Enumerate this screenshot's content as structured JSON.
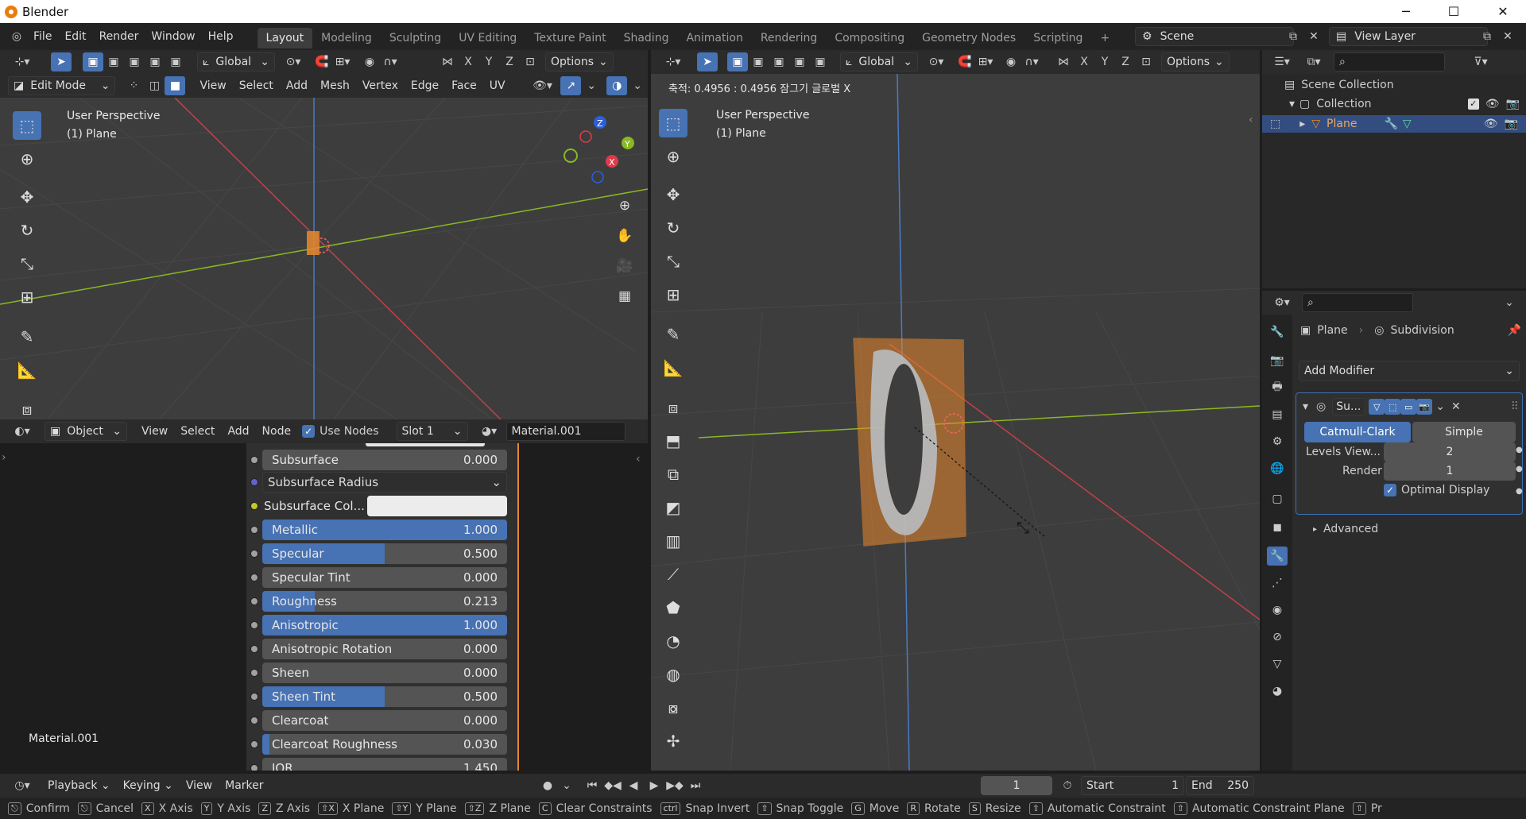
{
  "window": {
    "title": "Blender",
    "minimize": "─",
    "maximize": "☐",
    "close": "✕"
  },
  "menu": [
    "File",
    "Edit",
    "Render",
    "Window",
    "Help"
  ],
  "workspaces": [
    "Layout",
    "Modeling",
    "Sculpting",
    "UV Editing",
    "Texture Paint",
    "Shading",
    "Animation",
    "Rendering",
    "Compositing",
    "Geometry Nodes",
    "Scripting",
    "+"
  ],
  "active_workspace": "Layout",
  "scene": "Scene",
  "view_layer": "View Layer",
  "left_view": {
    "orientation": "Global",
    "options": "Options",
    "mode": "Edit Mode",
    "menus": [
      "View",
      "Select",
      "Add",
      "Mesh",
      "Vertex",
      "Edge",
      "Face",
      "UV"
    ],
    "overlay_title": "User Perspective",
    "overlay_sub": "(1) Plane"
  },
  "right_view": {
    "orientation": "Global",
    "options": "Options",
    "status": "축적: 0.4956 : 0.4956 잠그기 글로벌 X",
    "overlay_title": "User Perspective",
    "overlay_sub": "(1) Plane"
  },
  "node_editor": {
    "mode": "Object",
    "menus": [
      "View",
      "Select",
      "Add",
      "Node"
    ],
    "use_nodes": "Use Nodes",
    "slot": "Slot 1",
    "material": "Material.001",
    "footer_label": "Material.001",
    "subsurface_radius": "Subsurface Radius",
    "subsurface_color": "Subsurface Col...",
    "fields": [
      {
        "label": "Subsurface",
        "value": "0.000",
        "fill": 0,
        "color": "#a1a1a1"
      },
      {
        "label": "Metallic",
        "value": "1.000",
        "fill": 1.0,
        "color": "#a1a1a1"
      },
      {
        "label": "Specular",
        "value": "0.500",
        "fill": 0.5,
        "color": "#a1a1a1"
      },
      {
        "label": "Specular Tint",
        "value": "0.000",
        "fill": 0,
        "color": "#a1a1a1"
      },
      {
        "label": "Roughness",
        "value": "0.213",
        "fill": 0.213,
        "color": "#a1a1a1"
      },
      {
        "label": "Anisotropic",
        "value": "1.000",
        "fill": 1.0,
        "color": "#a1a1a1"
      },
      {
        "label": "Anisotropic Rotation",
        "value": "0.000",
        "fill": 0,
        "color": "#a1a1a1"
      },
      {
        "label": "Sheen",
        "value": "0.000",
        "fill": 0,
        "color": "#a1a1a1"
      },
      {
        "label": "Sheen Tint",
        "value": "0.500",
        "fill": 0.5,
        "color": "#a1a1a1"
      },
      {
        "label": "Clearcoat",
        "value": "0.000",
        "fill": 0,
        "color": "#a1a1a1"
      },
      {
        "label": "Clearcoat Roughness",
        "value": "0.030",
        "fill": 0.03,
        "color": "#a1a1a1"
      },
      {
        "label": "IOR",
        "value": "1.450",
        "fill": 0,
        "color": "#a1a1a1"
      }
    ]
  },
  "outliner": {
    "items": [
      {
        "label": "Scene Collection"
      },
      {
        "label": "Collection"
      },
      {
        "label": "Plane"
      }
    ]
  },
  "properties": {
    "object": "Plane",
    "modifier": "Subdivision",
    "add_modifier": "Add Modifier",
    "mod_short": "Su...",
    "catmull": "Catmull-Clark",
    "simple": "Simple",
    "levels_label": "Levels View...",
    "levels_value": "2",
    "render_label": "Render",
    "render_value": "1",
    "optimal": "Optimal Display",
    "advanced": "Advanced"
  },
  "timeline": {
    "menus": [
      "Playback",
      "Keying",
      "View",
      "Marker"
    ],
    "frame": "1",
    "start_label": "Start",
    "start": "1",
    "end_label": "End",
    "end": "250"
  },
  "statusbar": [
    {
      "key": "⎋",
      "label": "Confirm"
    },
    {
      "key": "⎋",
      "label": "Cancel"
    },
    {
      "key": "X",
      "label": "X Axis"
    },
    {
      "key": "Y",
      "label": "Y Axis"
    },
    {
      "key": "Z",
      "label": "Z Axis"
    },
    {
      "key": "⇧X",
      "label": "X Plane"
    },
    {
      "key": "⇧Y",
      "label": "Y Plane"
    },
    {
      "key": "⇧Z",
      "label": "Z Plane"
    },
    {
      "key": "C",
      "label": "Clear Constraints"
    },
    {
      "key": "ctrl",
      "label": "Snap Invert"
    },
    {
      "key": "⇧",
      "label": "Snap Toggle"
    },
    {
      "key": "G",
      "label": "Move"
    },
    {
      "key": "R",
      "label": "Rotate"
    },
    {
      "key": "S",
      "label": "Resize"
    },
    {
      "key": "⇧",
      "label": "Automatic Constraint"
    },
    {
      "key": "⇧",
      "label": "Automatic Constraint Plane"
    },
    {
      "key": "⇧",
      "label": "Pr"
    }
  ],
  "colors": {
    "accent": "#4772b3",
    "orange": "#e8892c",
    "x_axis": "#c2404a",
    "y_axis": "#8ab822"
  }
}
